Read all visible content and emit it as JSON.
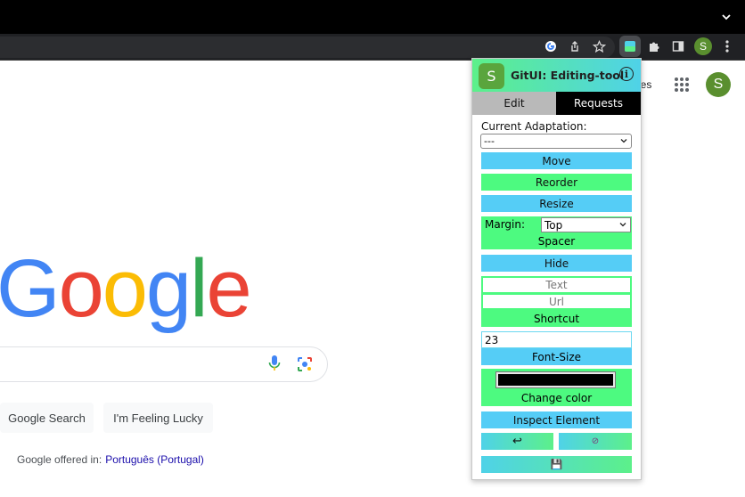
{
  "browser": {
    "profile_initial": "S"
  },
  "google": {
    "logo_letters": [
      {
        "char": "G",
        "color": "#4285f4"
      },
      {
        "char": "o",
        "color": "#ea4335"
      },
      {
        "char": "o",
        "color": "#fbbc05"
      },
      {
        "char": "g",
        "color": "#4285f4"
      },
      {
        "char": "l",
        "color": "#34a853"
      },
      {
        "char": "e",
        "color": "#ea4335"
      }
    ],
    "header_text_partial": "ges",
    "avatar_initial": "S",
    "search_button": "Google Search",
    "lucky_button": "I'm Feeling Lucky",
    "offered_in": "Google offered in:",
    "offered_language": "Português (Portugal)"
  },
  "extension": {
    "logo_initial": "S",
    "title": "GitUI: Editing-tool",
    "info_symbol": "i",
    "tabs": {
      "edit": "Edit",
      "requests": "Requests"
    },
    "current_adaptation_label": "Current Adaptation:",
    "current_adaptation_value": "---",
    "move": "Move",
    "reorder": "Reorder",
    "resize": "Resize",
    "margin_label": "Margin:",
    "margin_value": "Top",
    "spacer": "Spacer",
    "hide": "Hide",
    "text_placeholder": "Text",
    "url_placeholder": "Url",
    "shortcut": "Shortcut",
    "font_size_value": "23",
    "font_size": "Font-Size",
    "color_value": "#000000",
    "change_color": "Change color",
    "inspect_element": "Inspect Element",
    "undo_symbol": "↩",
    "reset_symbol": "⊘",
    "save_symbol": "💾",
    "colors": {
      "blue": "#55cdf6",
      "green": "#4dfa80",
      "edit_tab": "#b9b9b9",
      "requests_tab": "#000000"
    }
  }
}
